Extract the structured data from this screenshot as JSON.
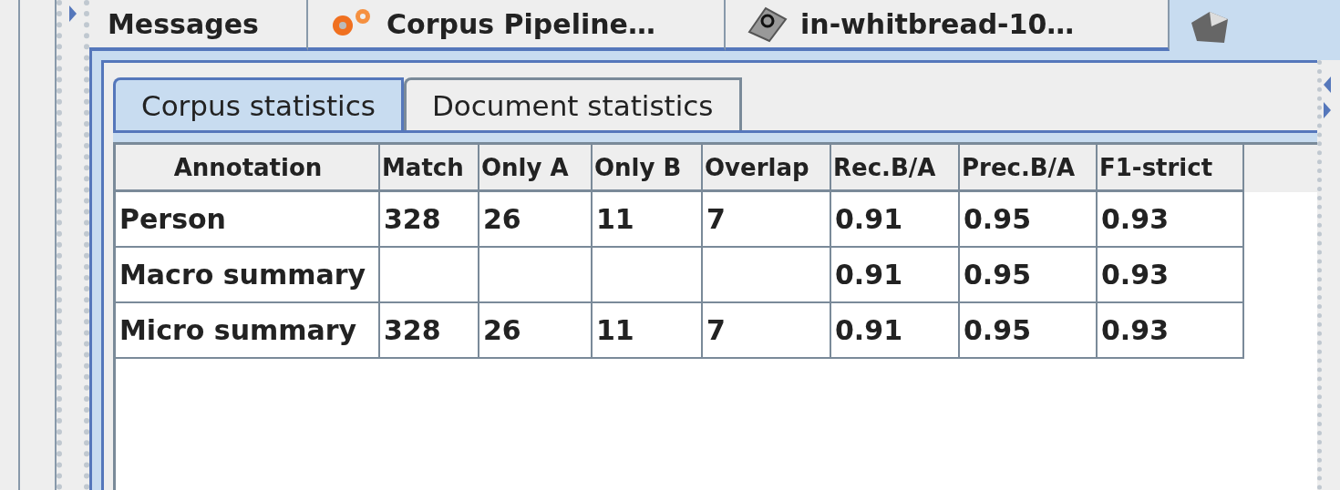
{
  "top_tabs": [
    {
      "label": "Messages",
      "selected": false
    },
    {
      "label": "Corpus Pipeline…",
      "selected": false,
      "kind": "gear"
    },
    {
      "label": "in-whitbread-10…",
      "selected": false,
      "kind": "document"
    },
    {
      "selected": true,
      "kind": "cube"
    }
  ],
  "inner_tabs": [
    {
      "label": "Corpus statistics",
      "selected": true
    },
    {
      "label": "Document statistics",
      "selected": false
    }
  ],
  "table": {
    "columns": [
      "Annotation",
      "Match",
      "Only A",
      "Only B",
      "Overlap",
      "Rec.B/A",
      "Prec.B/A",
      "F1-strict"
    ],
    "rows": [
      [
        "Person",
        "328",
        "26",
        "11",
        "7",
        "0.91",
        "0.95",
        "0.93"
      ],
      [
        "Macro summary",
        null,
        null,
        null,
        null,
        "0.91",
        "0.95",
        "0.93"
      ],
      [
        "Micro summary",
        "328",
        "26",
        "11",
        "7",
        "0.91",
        "0.95",
        "0.93"
      ]
    ]
  }
}
